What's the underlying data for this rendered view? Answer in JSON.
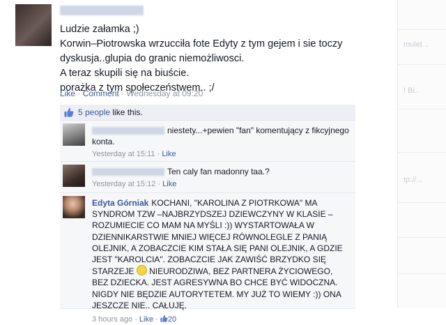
{
  "post": {
    "lines": [
      "Ludzie załamka ;)",
      "Korwin–Piotrowska wrzucciła fote Edyty z tym gejem i sie toczy",
      "dyskusja..glupia do granic niemożliwosci.",
      "A teraz skupili się na biuście.",
      "porażka z tym społeczeństwem.. ;/"
    ],
    "like_label": "Like",
    "comment_label": "Comment",
    "separator": "·",
    "timestamp": "Wednesday at 09:20"
  },
  "likes": {
    "count_text": "5 people",
    "suffix": " like this."
  },
  "comments": [
    {
      "text": "niestety...+pewien \"fan\" komentujący z fikcyjnego konta.",
      "time": "Yesterday at 15:11",
      "like_label": "Like"
    },
    {
      "text": "Ten caly fan madonny taa.?",
      "time": "Yesterday at 15:12",
      "like_label": "Like"
    },
    {
      "name": "Edyta Górniak",
      "text_part1": "KOCHANI, \"KAROLINA Z PIOTRKOWA\" MA SYNDROM TZW –NAJBRZYDSZEJ DZIEWCZYNY W KLASIE – ROZUMIECIE CO MAM NA MYŚLI :)) WYSTARTOWAŁA W DZIENNIKARSTWIE MNIEJ WIĘCEJ RÓWNOLEGLE Z PANIĄ OLEJNIK, A ZOBACZCIE KIM STAŁA SIĘ PANI OLEJNIK, A GDZIE JEST \"KAROLCIA\". ZOBACZCIE JAK ZAWIŚĆ BRZYDKO SIĘ STARZEJE",
      "text_part2": "NIEURODZIWA, BEZ PARTNERA ŻYCIOWEGO, BEZ DZIECKA. JEST AGRESYWNA BO CHCE BYĆ WIDOCZNA. NIGDY NIE BĘDZIE AUTORYTETEM. MY JUŻ TO WIEMY :)) ONA JESZCZE NIE.. CAŁUJĘ.",
      "time": "3 hours ago",
      "like_label": "Like",
      "like_count": "20"
    }
  ],
  "right_column": [
    "mulet ..",
    "! Bi..",
    "tp://..."
  ],
  "colors": {
    "link": "#3b5998",
    "meta": "#90949c",
    "panel": "#f6f7f9"
  }
}
